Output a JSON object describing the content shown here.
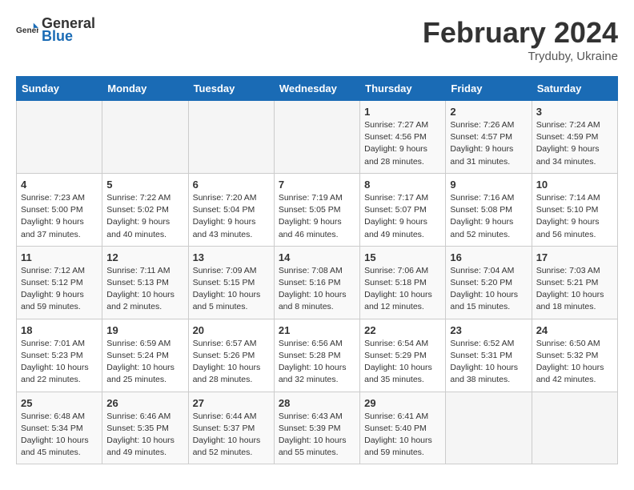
{
  "header": {
    "logo_general": "General",
    "logo_blue": "Blue",
    "month_title": "February 2024",
    "subtitle": "Tryduby, Ukraine"
  },
  "days_of_week": [
    "Sunday",
    "Monday",
    "Tuesday",
    "Wednesday",
    "Thursday",
    "Friday",
    "Saturday"
  ],
  "weeks": [
    [
      {
        "day": "",
        "info": ""
      },
      {
        "day": "",
        "info": ""
      },
      {
        "day": "",
        "info": ""
      },
      {
        "day": "",
        "info": ""
      },
      {
        "day": "1",
        "info": "Sunrise: 7:27 AM\nSunset: 4:56 PM\nDaylight: 9 hours\nand 28 minutes."
      },
      {
        "day": "2",
        "info": "Sunrise: 7:26 AM\nSunset: 4:57 PM\nDaylight: 9 hours\nand 31 minutes."
      },
      {
        "day": "3",
        "info": "Sunrise: 7:24 AM\nSunset: 4:59 PM\nDaylight: 9 hours\nand 34 minutes."
      }
    ],
    [
      {
        "day": "4",
        "info": "Sunrise: 7:23 AM\nSunset: 5:00 PM\nDaylight: 9 hours\nand 37 minutes."
      },
      {
        "day": "5",
        "info": "Sunrise: 7:22 AM\nSunset: 5:02 PM\nDaylight: 9 hours\nand 40 minutes."
      },
      {
        "day": "6",
        "info": "Sunrise: 7:20 AM\nSunset: 5:04 PM\nDaylight: 9 hours\nand 43 minutes."
      },
      {
        "day": "7",
        "info": "Sunrise: 7:19 AM\nSunset: 5:05 PM\nDaylight: 9 hours\nand 46 minutes."
      },
      {
        "day": "8",
        "info": "Sunrise: 7:17 AM\nSunset: 5:07 PM\nDaylight: 9 hours\nand 49 minutes."
      },
      {
        "day": "9",
        "info": "Sunrise: 7:16 AM\nSunset: 5:08 PM\nDaylight: 9 hours\nand 52 minutes."
      },
      {
        "day": "10",
        "info": "Sunrise: 7:14 AM\nSunset: 5:10 PM\nDaylight: 9 hours\nand 56 minutes."
      }
    ],
    [
      {
        "day": "11",
        "info": "Sunrise: 7:12 AM\nSunset: 5:12 PM\nDaylight: 9 hours\nand 59 minutes."
      },
      {
        "day": "12",
        "info": "Sunrise: 7:11 AM\nSunset: 5:13 PM\nDaylight: 10 hours\nand 2 minutes."
      },
      {
        "day": "13",
        "info": "Sunrise: 7:09 AM\nSunset: 5:15 PM\nDaylight: 10 hours\nand 5 minutes."
      },
      {
        "day": "14",
        "info": "Sunrise: 7:08 AM\nSunset: 5:16 PM\nDaylight: 10 hours\nand 8 minutes."
      },
      {
        "day": "15",
        "info": "Sunrise: 7:06 AM\nSunset: 5:18 PM\nDaylight: 10 hours\nand 12 minutes."
      },
      {
        "day": "16",
        "info": "Sunrise: 7:04 AM\nSunset: 5:20 PM\nDaylight: 10 hours\nand 15 minutes."
      },
      {
        "day": "17",
        "info": "Sunrise: 7:03 AM\nSunset: 5:21 PM\nDaylight: 10 hours\nand 18 minutes."
      }
    ],
    [
      {
        "day": "18",
        "info": "Sunrise: 7:01 AM\nSunset: 5:23 PM\nDaylight: 10 hours\nand 22 minutes."
      },
      {
        "day": "19",
        "info": "Sunrise: 6:59 AM\nSunset: 5:24 PM\nDaylight: 10 hours\nand 25 minutes."
      },
      {
        "day": "20",
        "info": "Sunrise: 6:57 AM\nSunset: 5:26 PM\nDaylight: 10 hours\nand 28 minutes."
      },
      {
        "day": "21",
        "info": "Sunrise: 6:56 AM\nSunset: 5:28 PM\nDaylight: 10 hours\nand 32 minutes."
      },
      {
        "day": "22",
        "info": "Sunrise: 6:54 AM\nSunset: 5:29 PM\nDaylight: 10 hours\nand 35 minutes."
      },
      {
        "day": "23",
        "info": "Sunrise: 6:52 AM\nSunset: 5:31 PM\nDaylight: 10 hours\nand 38 minutes."
      },
      {
        "day": "24",
        "info": "Sunrise: 6:50 AM\nSunset: 5:32 PM\nDaylight: 10 hours\nand 42 minutes."
      }
    ],
    [
      {
        "day": "25",
        "info": "Sunrise: 6:48 AM\nSunset: 5:34 PM\nDaylight: 10 hours\nand 45 minutes."
      },
      {
        "day": "26",
        "info": "Sunrise: 6:46 AM\nSunset: 5:35 PM\nDaylight: 10 hours\nand 49 minutes."
      },
      {
        "day": "27",
        "info": "Sunrise: 6:44 AM\nSunset: 5:37 PM\nDaylight: 10 hours\nand 52 minutes."
      },
      {
        "day": "28",
        "info": "Sunrise: 6:43 AM\nSunset: 5:39 PM\nDaylight: 10 hours\nand 55 minutes."
      },
      {
        "day": "29",
        "info": "Sunrise: 6:41 AM\nSunset: 5:40 PM\nDaylight: 10 hours\nand 59 minutes."
      },
      {
        "day": "",
        "info": ""
      },
      {
        "day": "",
        "info": ""
      }
    ]
  ]
}
